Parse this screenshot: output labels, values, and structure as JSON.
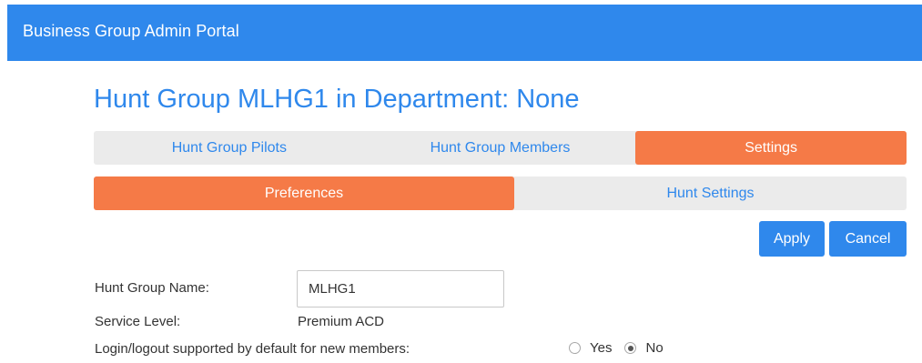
{
  "header": {
    "title": "Business Group Admin Portal"
  },
  "page": {
    "title": "Hunt Group MLHG1 in Department: None"
  },
  "main_tabs": [
    {
      "label": "Hunt Group Pilots",
      "active": false
    },
    {
      "label": "Hunt Group Members",
      "active": false
    },
    {
      "label": "Settings",
      "active": true
    }
  ],
  "sub_tabs": [
    {
      "label": "Preferences",
      "active": true
    },
    {
      "label": "Hunt Settings",
      "active": false
    }
  ],
  "actions": {
    "apply_label": "Apply",
    "cancel_label": "Cancel"
  },
  "form": {
    "hunt_group_name_label": "Hunt Group Name:",
    "hunt_group_name_value": "MLHG1",
    "service_level_label": "Service Level:",
    "service_level_value": "Premium ACD",
    "login_label": "Login/logout supported by default for new members:",
    "login_options": [
      {
        "label": "Yes",
        "selected": false
      },
      {
        "label": "No",
        "selected": true
      }
    ]
  },
  "colors": {
    "accent": "#2f88ec",
    "active_tab": "#f57a47",
    "tab_bg": "#ebebeb"
  }
}
